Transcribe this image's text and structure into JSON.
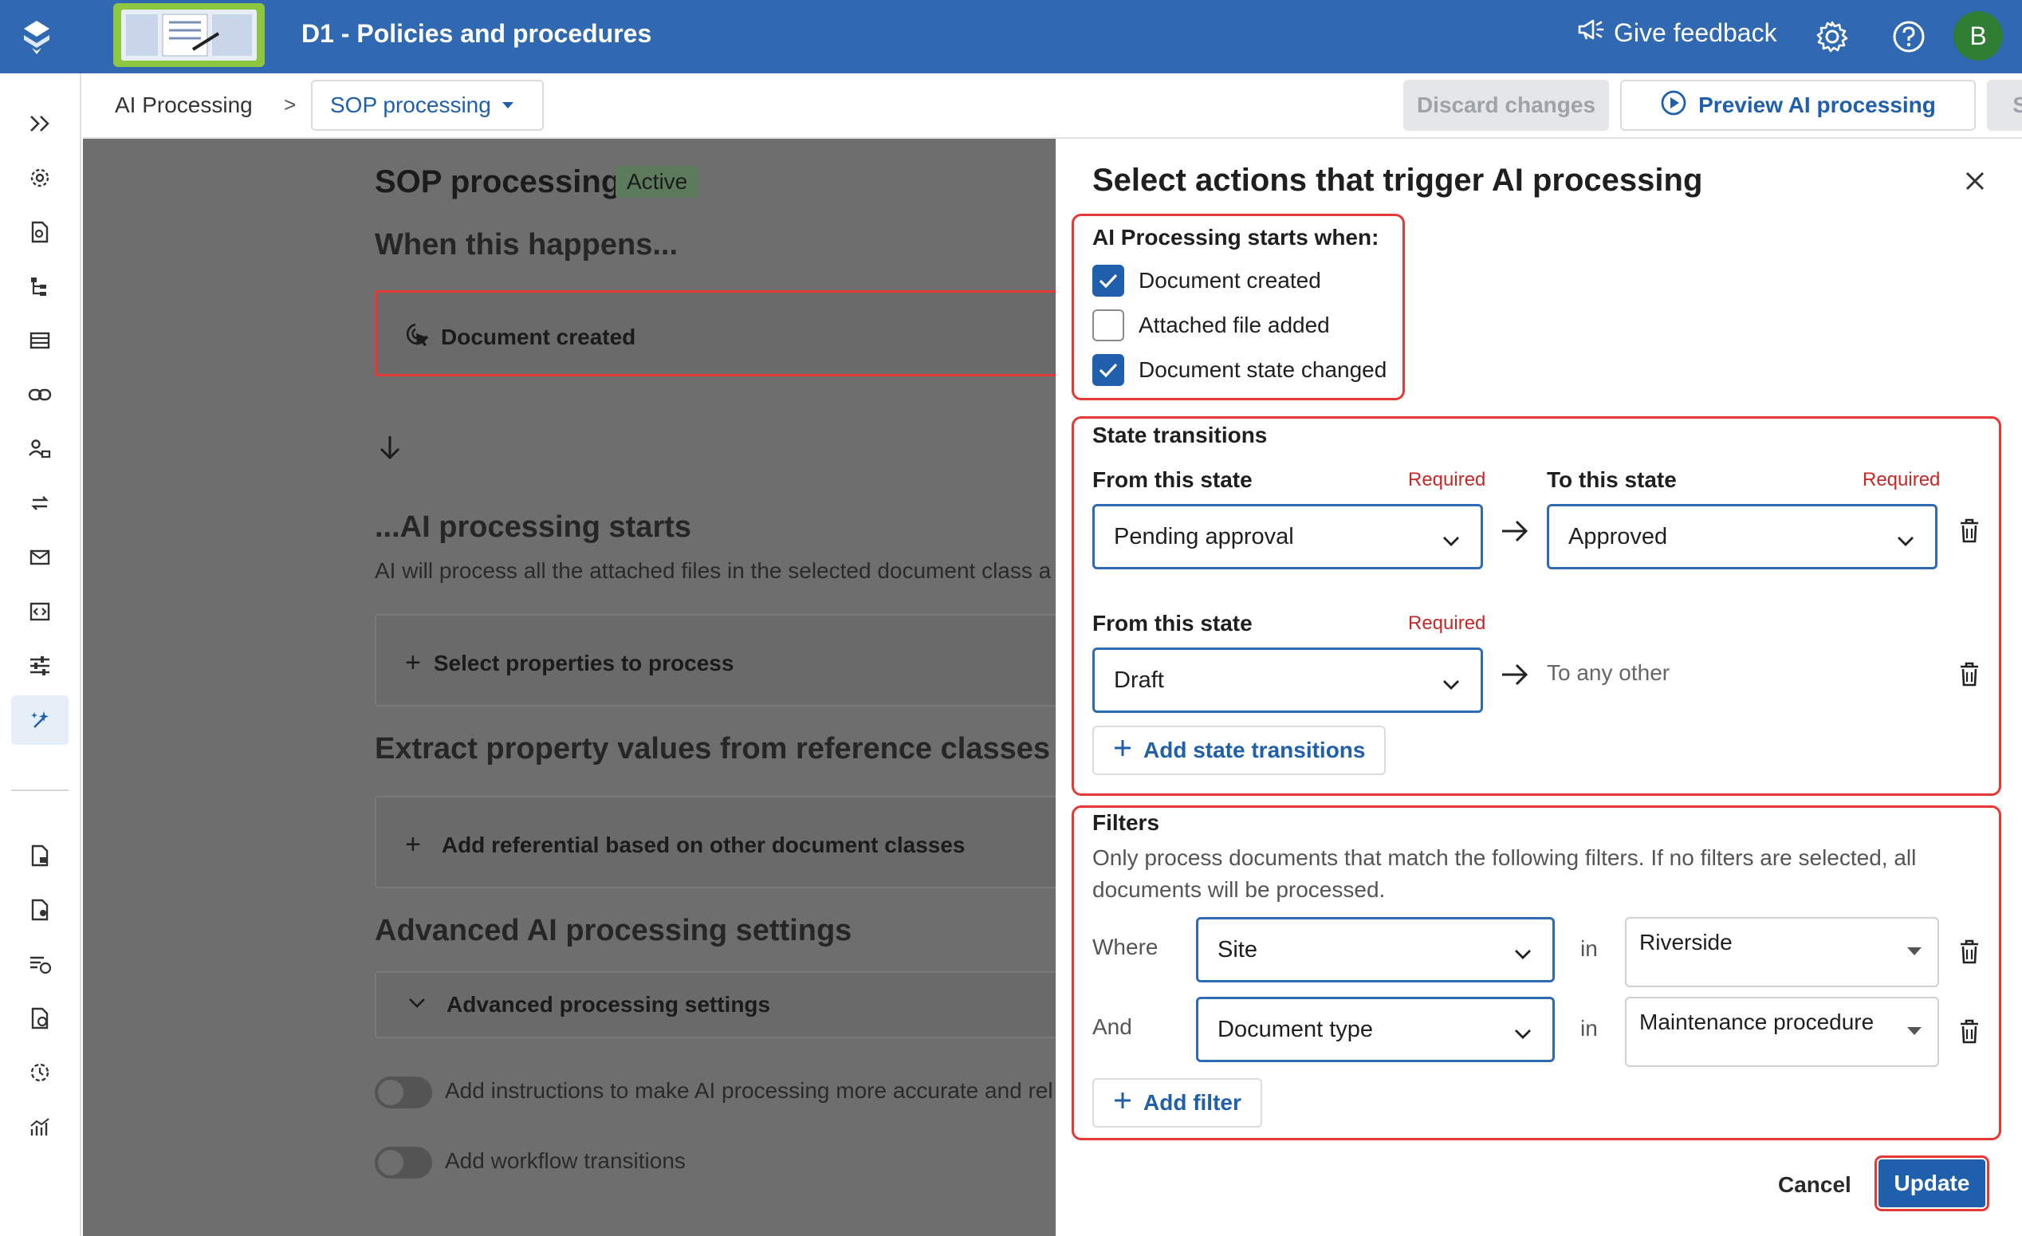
{
  "header": {
    "vault_title": "D1 - Policies and procedures",
    "feedback_label": "Give feedback",
    "avatar_initial": "B",
    "brand_color": "#3068b1"
  },
  "breadcrumb": {
    "root": "AI Processing",
    "separator": ">",
    "current": "SOP processing"
  },
  "toolbar": {
    "discard_label": "Discard changes",
    "preview_label": "Preview AI processing",
    "save_label": "Save"
  },
  "rail": {
    "items": [
      "expand-icon",
      "settings-icon",
      "document-search-icon",
      "hierarchy-icon",
      "list-icon",
      "link-icon",
      "user-group-icon",
      "sync-icon",
      "mail-icon",
      "code-icon",
      "sliders-icon",
      "ai-sparkle-icon",
      "document-lock-icon",
      "document-user-icon",
      "list-clock-icon",
      "document-clock-icon",
      "history-icon",
      "analytics-icon"
    ]
  },
  "background": {
    "title": "SOP processing",
    "status_badge": "Active",
    "when_heading": "When this happens...",
    "trigger_label": "Document created",
    "ai_heading": "...AI processing starts",
    "ai_sub": "AI will process all the attached files in the selected document class a",
    "select_props": "Select properties to process",
    "extract_heading": "Extract property values from reference classes",
    "add_referential": "Add referential based on other document classes",
    "advanced_heading": "Advanced AI processing settings",
    "advanced_settings": "Advanced processing settings",
    "toggle1_label": "Add instructions to make AI processing more accurate and rel",
    "toggle2_label": "Add workflow transitions"
  },
  "drawer": {
    "title": "Select actions that trigger AI processing",
    "starts_when_label": "AI Processing starts when:",
    "triggers": [
      {
        "label": "Document created",
        "checked": true
      },
      {
        "label": "Attached file added",
        "checked": false
      },
      {
        "label": "Document state changed",
        "checked": true
      }
    ],
    "state_transitions": {
      "heading": "State transitions",
      "from_label": "From this state",
      "to_label": "To this state",
      "required": "Required",
      "row1_from": "Pending approval",
      "row1_to": "Approved",
      "row2_from": "Draft",
      "row2_to": "To any other",
      "add_label": "Add state transitions"
    },
    "filters": {
      "heading": "Filters",
      "description": "Only process documents that match the following filters. If no filters are selected, all documents will be processed.",
      "rows": [
        {
          "conj": "Where",
          "field": "Site",
          "op": "in",
          "value": "Riverside"
        },
        {
          "conj": "And",
          "field": "Document type",
          "op": "in",
          "value": "Maintenance procedure"
        }
      ],
      "add_label": "Add filter"
    },
    "cancel_label": "Cancel",
    "update_label": "Update",
    "highlight_color": "#e53935",
    "accent_color": "#1f5fab"
  }
}
